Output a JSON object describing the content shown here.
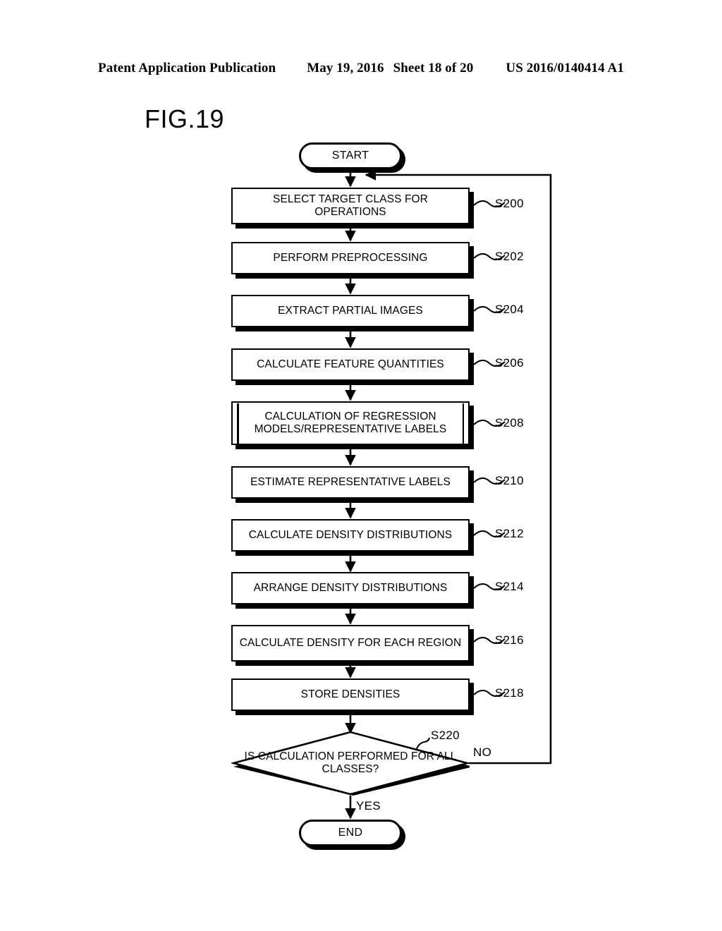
{
  "header": {
    "publication": "Patent Application Publication",
    "date": "May 19, 2016",
    "sheet": "Sheet 18 of 20",
    "patent_number": "US 2016/0140414 A1"
  },
  "figure": {
    "label": "FIG.19"
  },
  "flowchart": {
    "start": {
      "label": "START"
    },
    "end": {
      "label": "END"
    },
    "steps": [
      {
        "ref": "S200",
        "text": "SELECT TARGET CLASS FOR OPERATIONS",
        "shape": "process"
      },
      {
        "ref": "S202",
        "text": "PERFORM PREPROCESSING",
        "shape": "process"
      },
      {
        "ref": "S204",
        "text": "EXTRACT PARTIAL IMAGES",
        "shape": "process"
      },
      {
        "ref": "S206",
        "text": "CALCULATE FEATURE QUANTITIES",
        "shape": "process"
      },
      {
        "ref": "S208",
        "text": "CALCULATION OF REGRESSION MODELS/REPRESENTATIVE LABELS",
        "shape": "predefined-process"
      },
      {
        "ref": "S210",
        "text": "ESTIMATE REPRESENTATIVE LABELS",
        "shape": "process"
      },
      {
        "ref": "S212",
        "text": "CALCULATE DENSITY DISTRIBUTIONS",
        "shape": "process"
      },
      {
        "ref": "S214",
        "text": "ARRANGE DENSITY DISTRIBUTIONS",
        "shape": "process"
      },
      {
        "ref": "S216",
        "text": "CALCULATE DENSITY FOR EACH REGION",
        "shape": "process"
      },
      {
        "ref": "S218",
        "text": "STORE DENSITIES",
        "shape": "process"
      }
    ],
    "decision": {
      "ref": "S220",
      "text": "IS CALCULATION PERFORMED FOR ALL CLASSES?",
      "yes_label": "YES",
      "no_label": "NO"
    }
  },
  "colors": {
    "ink": "#000000",
    "paper": "#ffffff"
  }
}
